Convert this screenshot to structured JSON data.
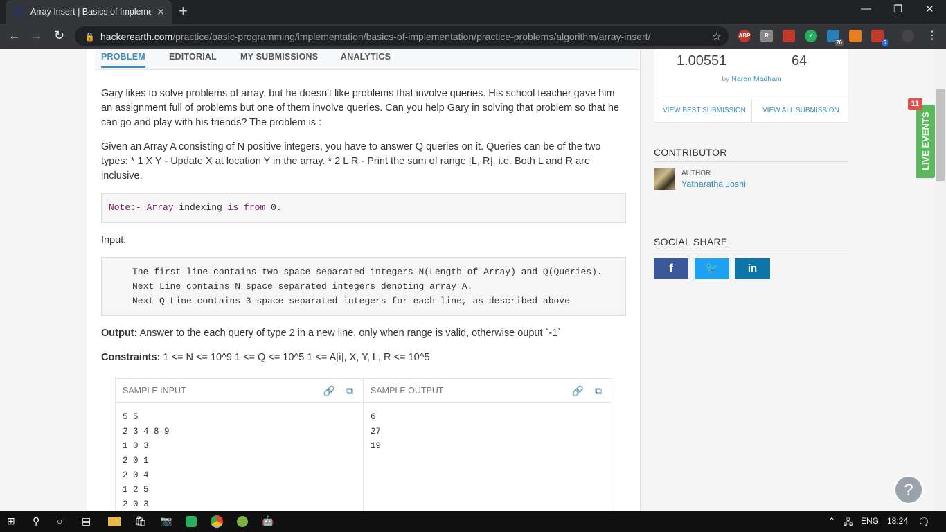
{
  "browser": {
    "tab_title": "Array Insert | Basics of Implementati",
    "url_host": "hackerearth.com",
    "url_path": "/practice/basic-programming/implementation/basics-of-implementation/practice-problems/algorithm/array-insert/",
    "ext_abp": "ABP",
    "ext_badge_1": "76",
    "ext_badge_2": "5"
  },
  "tabs": [
    "PROBLEM",
    "EDITORIAL",
    "MY SUBMISSIONS",
    "ANALYTICS"
  ],
  "problem": {
    "intro": "Gary likes to solve problems of array, but he doesn't like problems that involve queries. His school teacher gave him an assignment full of problems but one of them involve queries. Can you help Gary in solving that problem so that he can go and play with his friends? The problem is :",
    "description": "Given an Array A consisting of N positive integers, you have to answer Q queries on it. Queries can be of the two types: * 1 X Y - Update X at location Y in the array. * 2 L R - Print the sum of range [L, R], i.e. Both L and R are inclusive.",
    "note_kw1": "Note:- Array",
    "note_rest1": " indexing ",
    "note_kw2": "is from",
    "note_rest2": " 0.",
    "input_label": "Input:",
    "input_lines": [
      "The first line contains two space separated integers N(Length of Array) and Q(Queries).",
      "Next Line contains N space separated integers denoting array A.",
      "Next Q Line contains 3 space separated integers for each line, as described above"
    ],
    "output_label": "Output:",
    "output_text": " Answer to the each query of type 2 in a new line, only when range is valid, otherwise ouput `-1`",
    "constraints_label": "Constraints:",
    "constraints_text": " 1 <= N <= 10^9 1 <= Q <= 10^5 1 <= A[i], X, Y, L, R <= 10^5"
  },
  "sample": {
    "input_header": "SAMPLE INPUT",
    "output_header": "SAMPLE OUTPUT",
    "input": "5 5\n2 3 4 8 9\n1 0 3\n2 0 1\n2 0 4\n1 2 5\n2 0 3",
    "output": "6\n27\n19"
  },
  "sidebar": {
    "stat1": "1.00551",
    "stat2": "64",
    "by_prefix": "by",
    "by_name": "Naren Madham",
    "view_best": "VIEW BEST SUBMISSION",
    "view_all": "VIEW ALL SUBMISSION",
    "contributor_title": "CONTRIBUTOR",
    "author_label": "AUTHOR",
    "author_name": "Yatharatha Joshi",
    "social_title": "SOCIAL SHARE"
  },
  "live_events": {
    "label": "LIVE EVENTS",
    "count": "11"
  },
  "taskbar": {
    "lang": "ENG",
    "time": "18:24"
  },
  "colors": {
    "accent": "#3c8dbc",
    "facebook": "#3b5998",
    "twitter": "#1da1f2",
    "linkedin": "#0e76a8",
    "live": "#5cb85c"
  }
}
